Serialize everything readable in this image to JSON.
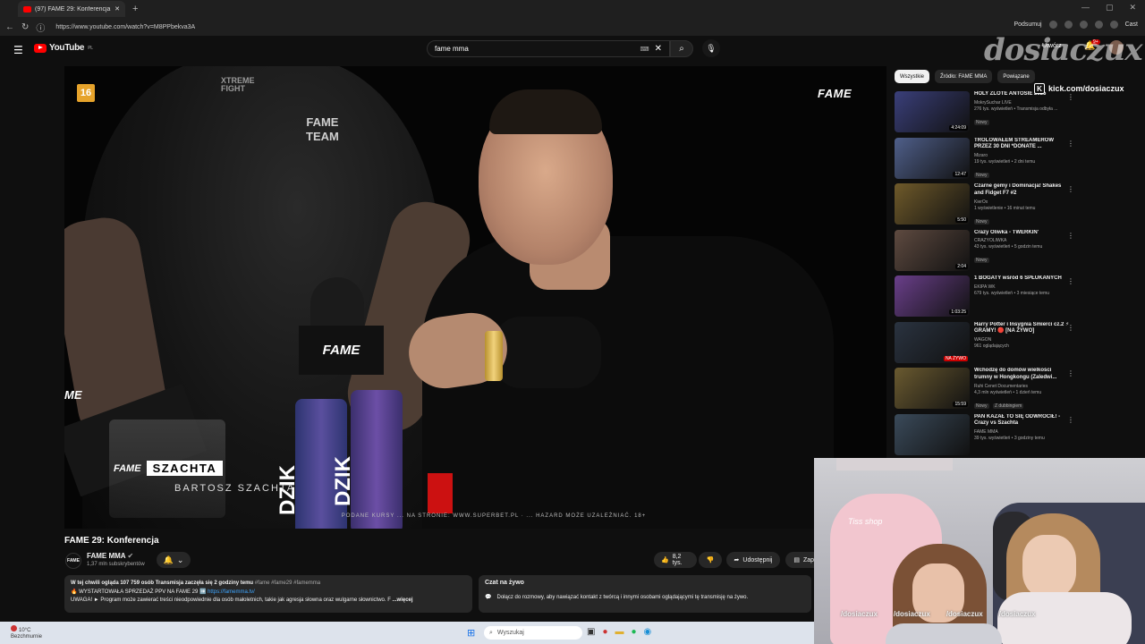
{
  "browser": {
    "tab_title": "(97) FAME 29: Konferencja - Y",
    "new_tab": "+",
    "url": "https://www.youtube.com/watch?v=M8PPbekva3A",
    "extensions": {
      "summarize": "Podsumuj",
      "cast": "Cast"
    }
  },
  "youtube": {
    "logo": "YouTube",
    "logo_region": "PL",
    "search": {
      "value": "fame mma"
    },
    "create_label": "Utwórz",
    "notifications": "9+"
  },
  "video": {
    "rating": "16",
    "fame_corner": "FAME",
    "shirt_text": "FAME\nTEAM",
    "mic_flag": "FAME",
    "can1_label": "DZIK",
    "can2_label": "DZIK",
    "lower_third": {
      "brand": "FAME",
      "name": "SZACHTA",
      "subtitle": "BARTOSZ SZACHTA"
    },
    "disclaimer": "PODANE KURSY ... NA STRONIE: WWW.SUPERBET.PL · ... HAZARD MOŻE UZALEŻNIAĆ. 18+",
    "title": "FAME 29: Konferencja"
  },
  "channel": {
    "logo": "FAME",
    "name": "FAME MMA",
    "subs": "1,37 mln subskrybentów"
  },
  "actions": {
    "likes": "8,2 tys.",
    "share": "Udostępnij",
    "save": "Zapisz"
  },
  "description": {
    "line1_bold": "W tej chwili ogląda 107 759 osób  Transmisja zaczęła się 2 godziny temu",
    "line1_tags": "#fame #fame29 #famemma",
    "line2_text": "🔥 WYSTARTOWAŁA SPRZEDAŻ PPV NA FAME 29 ➡️",
    "line2_link": "https://famemma.tv/",
    "line3": "UWAGA! ► Program może zawierać treści nieodpowiednie dla osób małoletnich, takie jak agresja słowna oraz wulgarne słownictwo. F",
    "more": "...więcej"
  },
  "chat": {
    "title": "Czat na żywo",
    "text": "Dołącz do rozmowy, aby nawiązać kontakt z twórcą i innymi osobami oglądającymi tę transmisję na żywo."
  },
  "chips": [
    "Wszystkie",
    "Źródło: FAME MMA",
    "Powiązane"
  ],
  "recommendations": [
    {
      "title": "HOLY ZLOTE ANTOSIE 2025",
      "channel": "MokrySuchar LIVE",
      "meta": "276 tys. wyświetleń • Transmisja odbyła ...",
      "badge": "Nowy",
      "duration": "4:24:09",
      "thumb_color": "#3a3f7a"
    },
    {
      "title": "TROLOWAŁEM STREAMERÓW PRZEZ 30 DNI *DONATE ...",
      "channel": "Mizaro",
      "meta": "19 tys. wyświetleń • 2 dni temu",
      "badge": "Nowy",
      "duration": "12:47",
      "thumb_color": "#4f5f8a"
    },
    {
      "title": "Czarne gemy i Dominacja! Shakes and Fidget F7 #2",
      "channel": "KierOx",
      "meta": "1 wyświetlenie • 16 minut temu",
      "badge": "Nowy",
      "duration": "5:50",
      "thumb_color": "#6f5a2a"
    },
    {
      "title": "Crazy Oliwka - TWERKIN'",
      "channel": "CRAZYOLIWKA",
      "meta": "43 tys. wyświetleń • 5 godzin temu",
      "badge": "Nowy",
      "duration": "2:04",
      "thumb_color": "#5e4a40"
    },
    {
      "title": "1 BOGATY wśród 6 SPŁUKANYCH",
      "channel": "EKIPA WK",
      "meta": "679 tys. wyświetleń • 3 miesiące temu",
      "badge": "",
      "duration": "1:03:25",
      "thumb_color": "#6a3f8a"
    },
    {
      "title": "Harry Potter i Insygnia Śmierci cz.2 ⚡ GRAMY! 🔴 [NA ŻYWO]",
      "channel": "WAGON",
      "meta": "961 oglądających",
      "badge": "",
      "duration": "NA ŻYWO",
      "thumb_color": "#2a3340"
    },
    {
      "title": "Wchodzę do domów wielkości trumny w Hongkongu (Zaledwi...",
      "channel": "Ruhi Cenet Documentaries",
      "meta": "4,3 mln wyświetleń • 1 dzień temu",
      "badge": "Nowy",
      "badge2": "Z dubbingiem",
      "duration": "15:59",
      "thumb_color": "#6a5a30"
    },
    {
      "title": "PAN KAZAŁ TO SIĘ ODWRÓCIŁ! - Crazy vs Szachta",
      "channel": "FAME MMA",
      "meta": "39 tys. wyświetleń • 3 godziny temu",
      "badge": "",
      "duration": "",
      "thumb_color": "#3a4a5a"
    }
  ],
  "overlay": {
    "watermark": "dosiaczux",
    "kick": "kick.com/dosiaczux"
  },
  "webcam": {
    "chair_text": "Tiss shop",
    "socials": [
      "/dosiaczux",
      "/dosiaczux",
      "/dosiaczux",
      "/dosiaczux"
    ]
  },
  "taskbar": {
    "temp": "10°C",
    "weather": "Bezchmurnie",
    "search": "Wyszukaj"
  }
}
